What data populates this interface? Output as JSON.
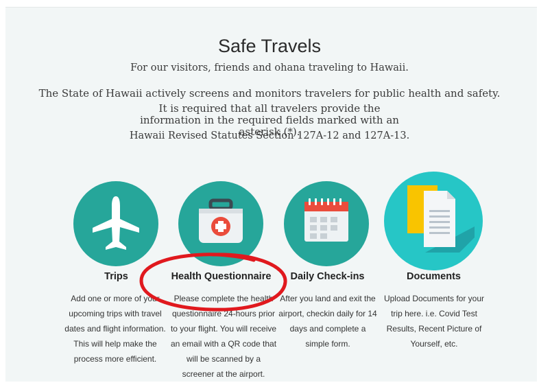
{
  "header": {
    "title": "Safe Travels",
    "subtitle": "For our visitors, friends and ohana traveling to Hawaii.",
    "para1": "The State of Hawaii actively screens and monitors travelers for public health and safety.",
    "para2": "It is required that all travelers provide the information in the required fields marked with an asterisk (*).",
    "para3": "Hawaii Revised Statutes Section 127A-12 and 127A-13."
  },
  "cards": [
    {
      "title": "Trips",
      "desc": "Add one or more of your upcoming trips with travel dates and flight information. This will help make the process more efficient.",
      "icon": "airplane-icon"
    },
    {
      "title": "Health Questionnaire",
      "desc": "Please complete the health questionnaire 24-hours prior to your flight. You will receive an email with a QR code that will be scanned by a screener at the airport.",
      "icon": "first-aid-kit-icon"
    },
    {
      "title": "Daily Check-ins",
      "desc": "After you land and exit the airport, checkin daily for 14 days and complete a simple form.",
      "icon": "calendar-icon"
    },
    {
      "title": "Documents",
      "desc": "Upload Documents for your trip here. i.e. Covid Test Results, Recent Picture of Yourself, etc.",
      "icon": "documents-icon"
    }
  ],
  "colors": {
    "teal": "#26a69a",
    "annotation": "#e0191e"
  }
}
